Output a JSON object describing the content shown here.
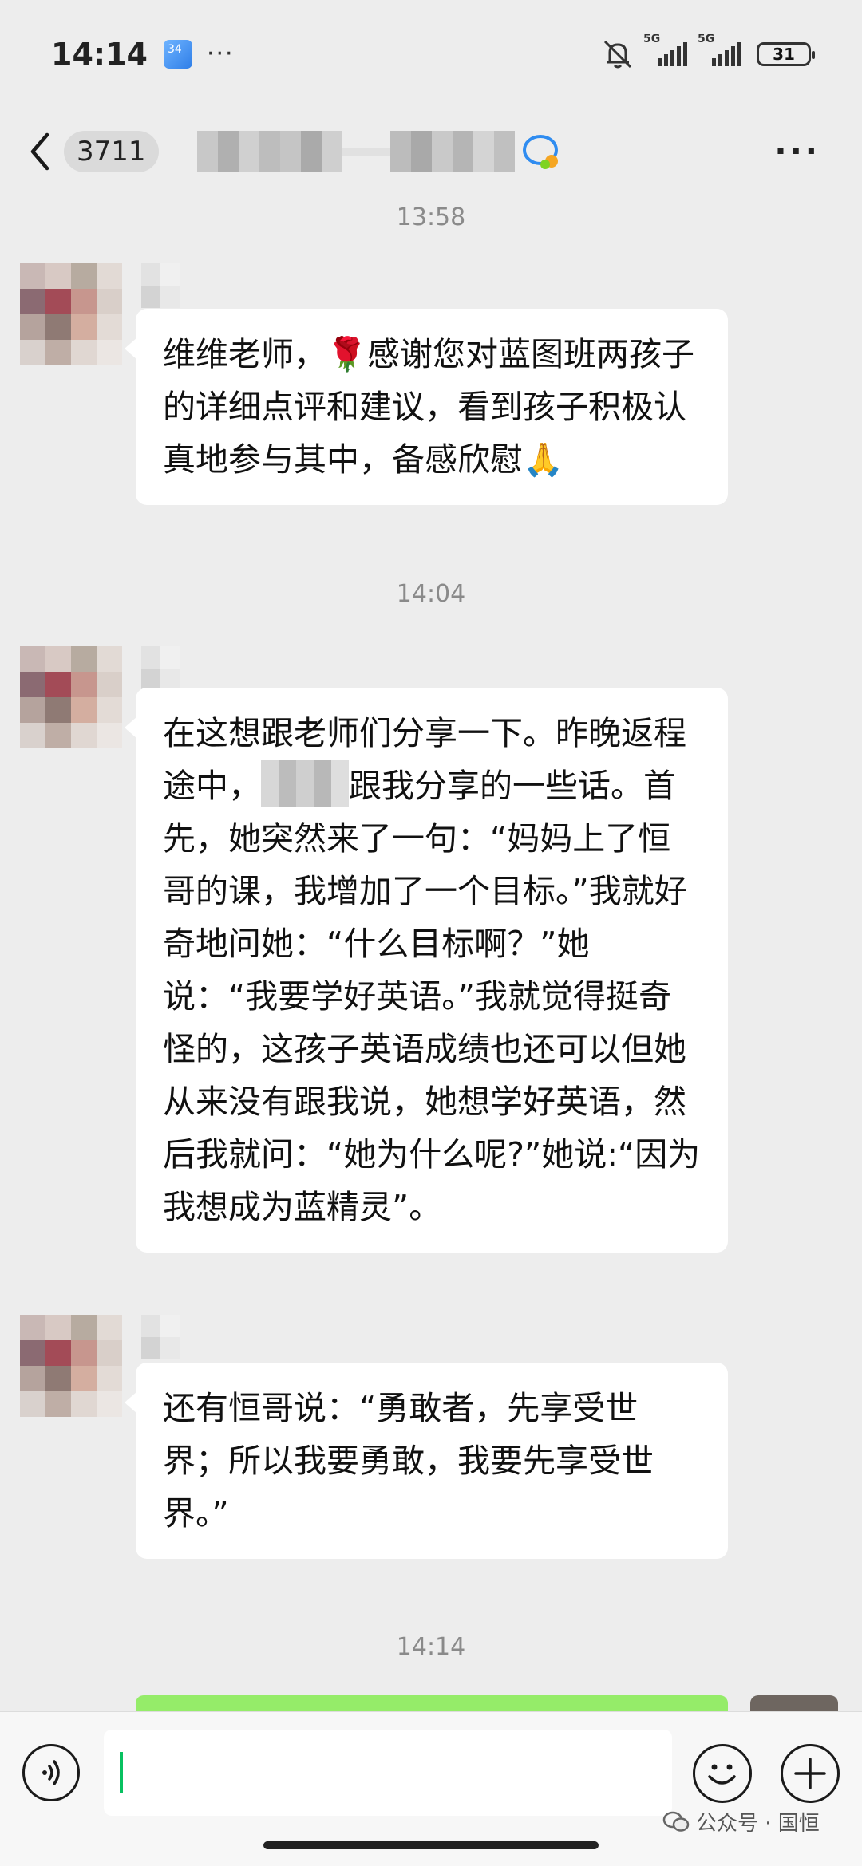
{
  "status_bar": {
    "time": "14:14",
    "weather_temp": "34",
    "more": "···",
    "signal1_label": "5G",
    "signal2_label": "5G",
    "battery": "31"
  },
  "nav": {
    "unread_count": "3711",
    "more": "···"
  },
  "chat": {
    "timestamps": [
      "13:58",
      "14:04",
      "14:14"
    ],
    "messages": [
      {
        "text": "维维老师，🌹感谢您对蓝图班两孩子的详细点评和建议，看到孩子积极认真地参与其中，备感欣慰🙏"
      },
      {
        "text_before": "在这想跟老师们分享一下。昨晚返程途中，",
        "text_after": "跟我分享的一些话。首先，她突然来了一句：“妈妈上了恒哥的课，我增加了一个目标。”我就好奇地问她：“什么目标啊？”她说：“我要学好英语。”我就觉得挺奇怪的，这孩子英语成绩也还可以但她从来没有跟我说，她想学好英语，然后我就问：“她为什么呢?”她说:“因为我想成为蓝精灵”。"
      },
      {
        "text": "还有恒哥说：“勇敢者，先享受世界；所以我要勇敢，我要先享受世界。”"
      }
    ]
  },
  "watermark": {
    "text": "公众号 · 国恒"
  },
  "colors": {
    "background": "#ededed",
    "bubble": "#ffffff",
    "sent_bubble": "#95ec69",
    "cursor": "#07c160"
  }
}
